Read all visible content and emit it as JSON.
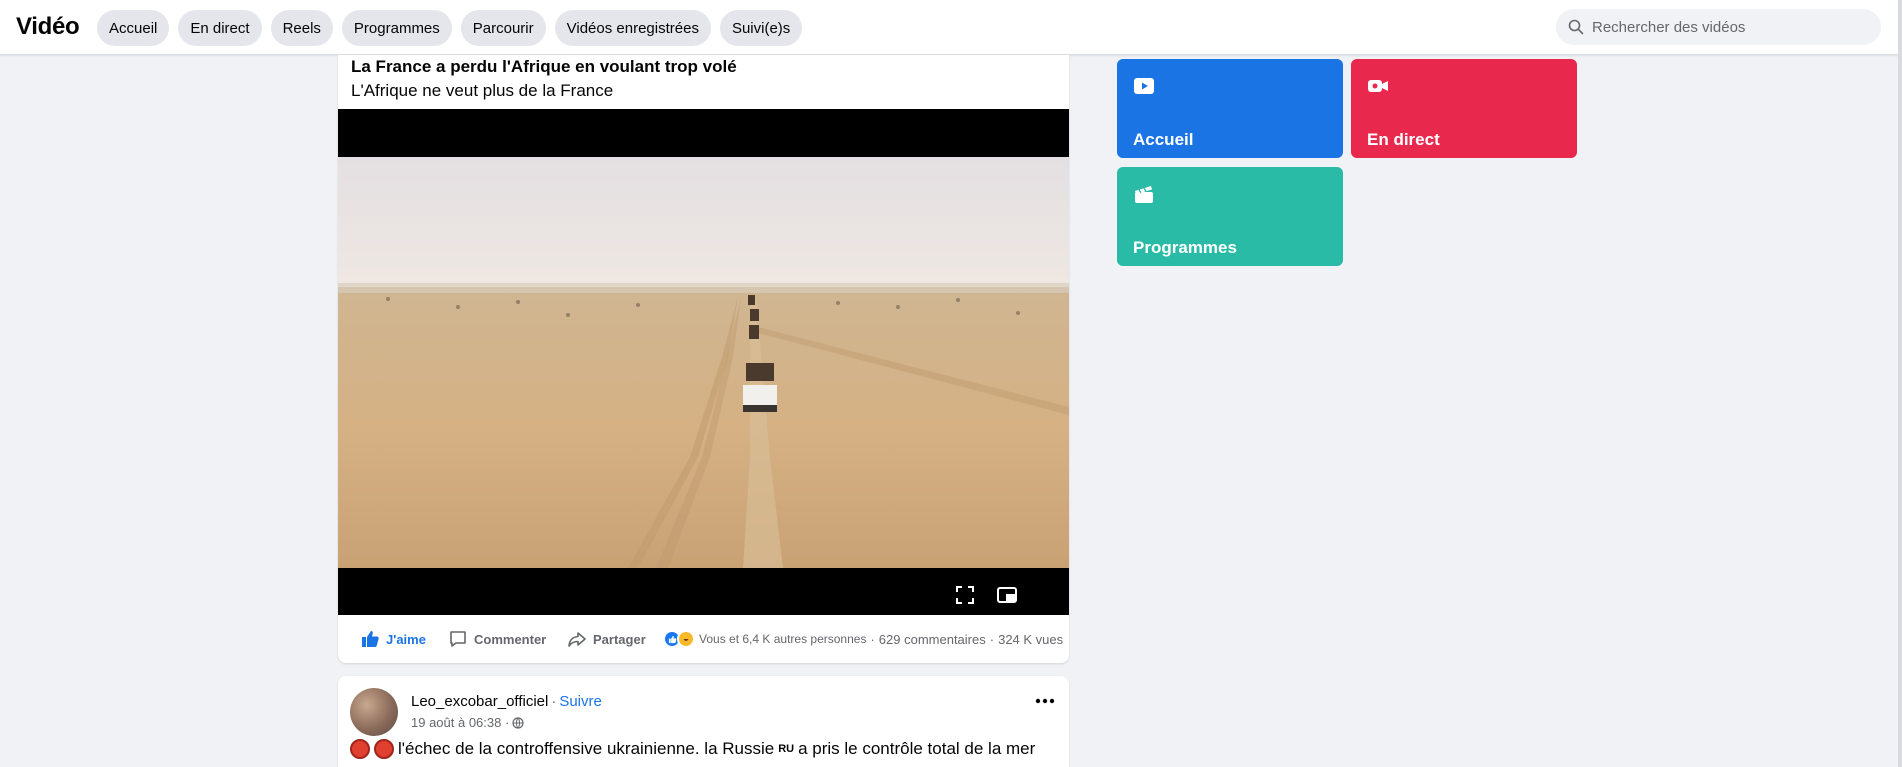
{
  "header": {
    "brand": "Vidéo",
    "nav": [
      "Accueil",
      "En direct",
      "Reels",
      "Programmes",
      "Parcourir",
      "Vidéos enregistrées",
      "Suivi(e)s"
    ],
    "search_placeholder": "Rechercher des vidéos"
  },
  "video_post": {
    "title": "La France a perdu l'Afrique en voulant trop volé",
    "subtitle": "L'Afrique ne veut plus de la France",
    "actions": {
      "like": "J'aime",
      "comment": "Commenter",
      "share": "Partager"
    },
    "reactions_text": "Vous et 6,4 K autres personnes",
    "comments_count": "629 commentaires",
    "views": "324 K vues"
  },
  "second_post": {
    "author": "Leo_excobar_officiel",
    "separator": "·",
    "follow": "Suivre",
    "timestamp": "19 août à 06:38 ·",
    "text": "l'échec de la controffensive ukrainienne. la Russie",
    "flag": "RU",
    "text_after_flag": "a pris le contrôle total de la mer"
  },
  "tiles": [
    {
      "label": "Accueil",
      "color": "#1b74e4",
      "icon": "video-play-icon"
    },
    {
      "label": "En direct",
      "color": "#e9284e",
      "icon": "live-camera-icon"
    },
    {
      "label": "Programmes",
      "color": "#2abba7",
      "icon": "clapperboard-icon"
    }
  ],
  "colors": {
    "accent": "#1b74e4",
    "background": "#f0f2f5"
  }
}
